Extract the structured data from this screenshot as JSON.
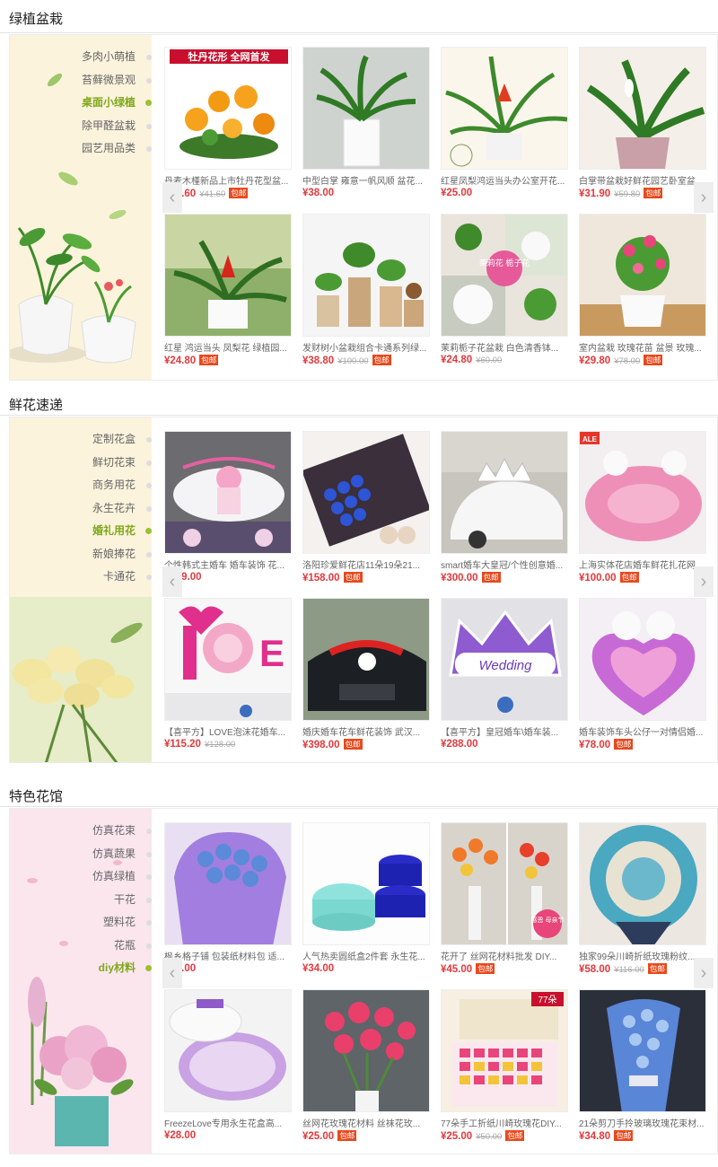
{
  "sections": [
    {
      "title": "绿植盆栽",
      "theme": "#fbf3dc",
      "categories": [
        "多肉小萌植",
        "苔藓微景观",
        "桌面小绿植",
        "除甲醛盆栽",
        "园艺用品类"
      ],
      "active_index": 2,
      "products": [
        {
          "name": "丹麦木槿新品上市牡丹花型盆...",
          "price": "¥36.60",
          "old_price": "¥41.60",
          "free": "包邮",
          "badge": "牡丹花形  全网首发"
        },
        {
          "name": "中型白掌 雍意一帆风顺 盆花...",
          "price": "¥38.00",
          "old_price": "",
          "free": ""
        },
        {
          "name": "红星凤梨鸿运当头办公室开花...",
          "price": "¥25.00",
          "old_price": "",
          "free": ""
        },
        {
          "name": "白掌带盆栽好鲜花园艺卧室盆...",
          "price": "¥31.90",
          "old_price": "¥59.80",
          "free": "包邮"
        },
        {
          "name": "红星 鸿运当头 凤梨花 绿植园...",
          "price": "¥24.80",
          "old_price": "",
          "free": "包邮"
        },
        {
          "name": "发财树小盆栽组合卡通系列绿...",
          "price": "¥38.80",
          "old_price": "¥100.00",
          "free": "包邮"
        },
        {
          "name": "茉莉栀子花盆栽 白色清香钵...",
          "price": "¥24.80",
          "old_price": "¥60.00",
          "free": "",
          "badge": "茉莉花 栀子花"
        },
        {
          "name": "室内盆栽 玫瑰花苗 盆景 玫瑰...",
          "price": "¥29.80",
          "old_price": "¥78.00",
          "free": "包邮"
        }
      ]
    },
    {
      "title": "鲜花速递",
      "theme": "#fbf3dc",
      "categories": [
        "定制花盒",
        "鲜切花束",
        "商务用花",
        "永生花卉",
        "婚礼用花",
        "新娘捧花",
        "卡通花"
      ],
      "active_index": 4,
      "products": [
        {
          "name": "个性韩式主婚车 婚车装饰 花...",
          "price": "¥169.00",
          "old_price": "",
          "free": ""
        },
        {
          "name": "洛阳珍爱鲜花店11朵19朵21...",
          "price": "¥158.00",
          "old_price": "",
          "free": "包邮"
        },
        {
          "name": "smart婚车大皇冠/个性创意婚...",
          "price": "¥300.00",
          "old_price": "",
          "free": "包邮"
        },
        {
          "name": "上海实体花店婚车鲜花扎花网...",
          "price": "¥100.00",
          "old_price": "",
          "free": "包邮",
          "badge": "ALE"
        },
        {
          "name": "【喜平方】LOVE泡沫花婚车...",
          "price": "¥115.20",
          "old_price": "¥128.00",
          "free": ""
        },
        {
          "name": "婚庆婚车花车鲜花装饰 武汉...",
          "price": "¥398.00",
          "old_price": "",
          "free": "包邮"
        },
        {
          "name": "【喜平方】皇冠婚车\\婚车装...",
          "price": "¥288.00",
          "old_price": "",
          "free": "",
          "badge": "Wedding"
        },
        {
          "name": "婚车装饰车头公仔一对情侣婚...",
          "price": "¥78.00",
          "old_price": "",
          "free": "包邮"
        }
      ]
    },
    {
      "title": "特色花馆",
      "theme": "#fbe6ee",
      "categories": [
        "仿真花束",
        "仿真蔬果",
        "仿真绿植",
        "干花",
        "塑料花",
        "花瓶",
        "diy材料"
      ],
      "active_index": 6,
      "products": [
        {
          "name": "枫乡格子铺 包装纸材料包 适...",
          "price": "¥35.00",
          "old_price": "",
          "free": ""
        },
        {
          "name": "人气热卖圆纸盒2件套 永生花...",
          "price": "¥34.00",
          "old_price": "",
          "free": ""
        },
        {
          "name": "花开了 丝网花材料批发 DIY...",
          "price": "¥45.00",
          "old_price": "",
          "free": "包邮",
          "badge": "感恩 母亲节"
        },
        {
          "name": "独家99朵川崎折纸玫瑰粉纹...",
          "price": "¥58.00",
          "old_price": "¥116.00",
          "free": "包邮"
        },
        {
          "name": "FreezeLove专用永生花盒高...",
          "price": "¥28.00",
          "old_price": "",
          "free": ""
        },
        {
          "name": "丝网花玫瑰花材料 丝袜花玫...",
          "price": "¥25.00",
          "old_price": "",
          "free": "包邮"
        },
        {
          "name": "77朵手工折纸川崎玫瑰花DIY...",
          "price": "¥25.00",
          "old_price": "¥50.00",
          "free": "包邮",
          "badge": "77朵"
        },
        {
          "name": "21朵剪刀手拎玻璃玫瑰花束材...",
          "price": "¥34.80",
          "old_price": "",
          "free": "包邮"
        }
      ]
    }
  ],
  "icons": {
    "prev": "chevron-left-icon",
    "next": "chevron-right-icon"
  },
  "colors": {
    "price": "#e4393c",
    "active": "#7ea81a",
    "free_badge": "#e8491d"
  }
}
